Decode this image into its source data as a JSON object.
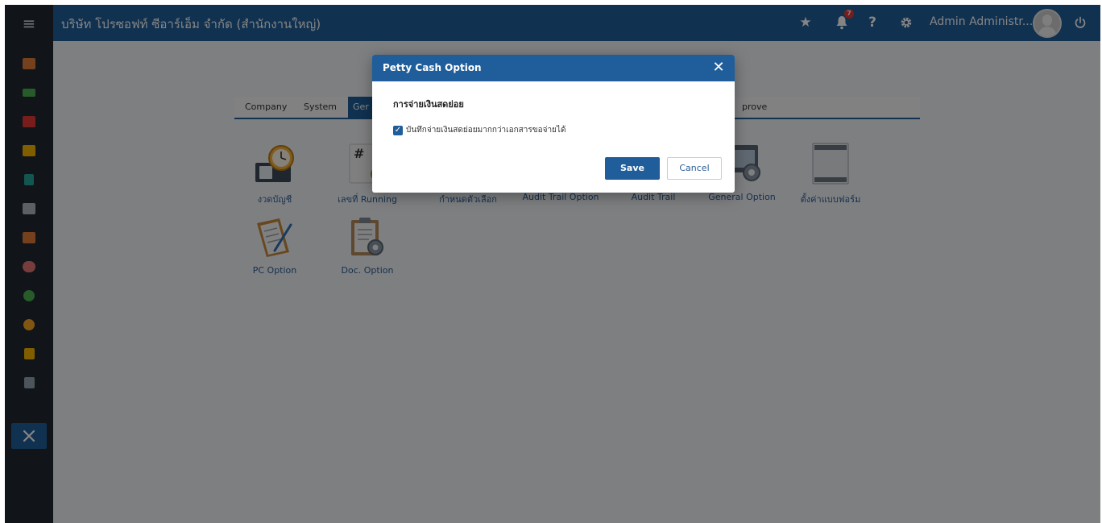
{
  "topbar": {
    "menu_icon": "hamburger-icon",
    "company_name": "บริษัท โปรซอฟท์ ซีอาร์เอ็ม จำกัด (สำนักงานใหญ่)",
    "notification_count": "7",
    "help_label": "?",
    "admin_name": "Admin Administr...",
    "icons": [
      "star-icon",
      "bell-icon",
      "help-icon",
      "gear-icon",
      "avatar",
      "power-icon"
    ]
  },
  "sidebar": {
    "items": [
      {
        "icon": "dashboard-icon",
        "color": "#e07b39"
      },
      {
        "icon": "money-icon",
        "color": "#4caf50"
      },
      {
        "icon": "cart-icon",
        "color": "#e53935"
      },
      {
        "icon": "box-icon",
        "color": "#f5b400"
      },
      {
        "icon": "book-icon",
        "color": "#26a69a"
      },
      {
        "icon": "bank-icon",
        "color": "#b0b7bf"
      },
      {
        "icon": "briefcase-icon",
        "color": "#e07b39"
      },
      {
        "icon": "user-icon",
        "color": "#e57373"
      },
      {
        "icon": "check-icon",
        "color": "#4caf50"
      },
      {
        "icon": "pie-chart-icon",
        "color": "#f5a623"
      },
      {
        "icon": "report-icon",
        "color": "#f5b400"
      },
      {
        "icon": "search-document-icon",
        "color": "#90a4ae"
      },
      {
        "icon": "tools-icon",
        "color": "#ffffff"
      }
    ]
  },
  "tabs": {
    "company": "Company",
    "system": "System",
    "general_partial": "Ger",
    "approve_partial": "prove"
  },
  "tiles": [
    {
      "label": "งวดบัญชี",
      "icon": "accounting-period-icon"
    },
    {
      "label": "เลขที่ Running",
      "icon": "running-number-icon"
    },
    {
      "label": "กำหนดตัวเลือก",
      "icon": "define-option-icon"
    },
    {
      "label": "Audit Trail Option",
      "icon": "audit-trail-option-icon"
    },
    {
      "label": "Audit Trail",
      "icon": "audit-trail-icon"
    },
    {
      "label": "General Option",
      "icon": "general-option-icon"
    },
    {
      "label": "ตั้งค่าแบบฟอร์ม",
      "icon": "form-settings-icon"
    },
    {
      "label": "PC Option",
      "icon": "pc-option-icon"
    },
    {
      "label": "Doc. Option",
      "icon": "doc-option-icon"
    }
  ],
  "modal": {
    "title": "Petty Cash Option",
    "close_label": "✕",
    "section_title": "การจ่ายเงินสดย่อย",
    "checkbox_label": "บันทึกจ่ายเงินสดย่อยมากกว่าเอกสารขอจ่ายได้",
    "checkbox_checked": true,
    "save_label": "Save",
    "cancel_label": "Cancel"
  },
  "colors": {
    "brand_blue": "#1f5e9a",
    "sidebar_dark": "#222a32",
    "badge_red": "#e53935"
  }
}
